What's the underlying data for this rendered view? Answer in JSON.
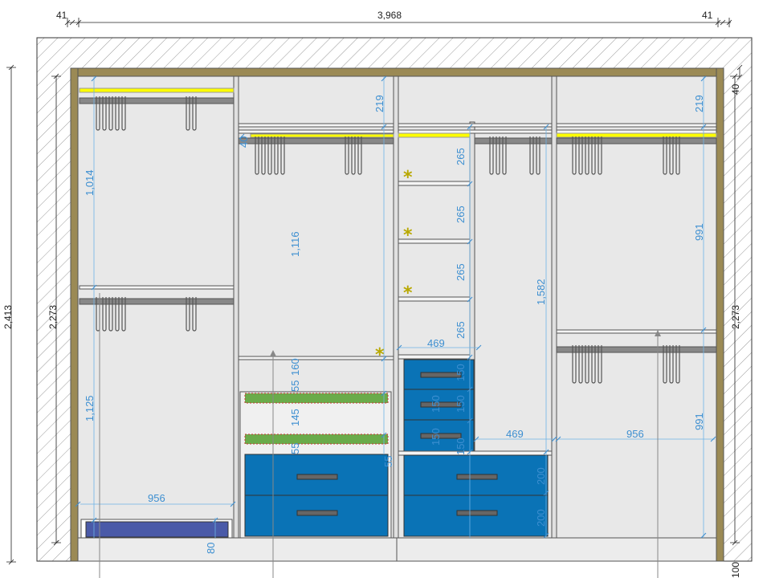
{
  "colors": {
    "frame": "#9b8a55",
    "panel": "#e8e8e8",
    "drawer": "#0a73b6",
    "shelf_green": "#6aab4a",
    "light_strip": "#ffff00",
    "rail": "#888888",
    "tray": "#4a5aa8",
    "dimension": "#3d8fd1",
    "star": "#b8a800"
  },
  "dimensions": {
    "top_left_wall": "41",
    "top_total_width": "3,968",
    "top_right_wall": "41",
    "left_total_height": "2,413",
    "left_inner_height": "2,273",
    "right_inner_height": "2,273",
    "right_top_gap": "40",
    "right_bottom_gap": "100",
    "sec1_upper_height": "1,014",
    "sec1_lower_height": "1,125",
    "sec1_inner_width": "956",
    "sec1_tray_height": "80",
    "sec2_top_gap": "219",
    "sec2_rail_gap": "40",
    "sec2_hang_height": "1,116",
    "sec2_gap_160": "160",
    "sec2_gap_55a": "55",
    "sec2_gap_145": "145",
    "sec2_gap_55b": "55",
    "sec2_gap_55c": "55",
    "sec3_shelf_1": "265",
    "sec3_shelf_2": "265",
    "sec3_shelf_3": "265",
    "sec3_shelf_4": "265",
    "sec3_inner_width": "469",
    "sec3_drawer_1": "150",
    "sec3_drawer_2": "150",
    "sec3_drawer_3": "150",
    "sec3_drawer_4": "150",
    "sec3_drawer_5": "150",
    "sec3_right_height": "1,582",
    "sec3_right_width": "469",
    "sec3_big_drawer_1": "200",
    "sec3_big_drawer_2": "200",
    "sec4_top_gap": "219",
    "sec4_upper_height": "991",
    "sec4_lower_height": "991",
    "sec4_inner_width": "956"
  },
  "markers": {
    "star": "*"
  }
}
